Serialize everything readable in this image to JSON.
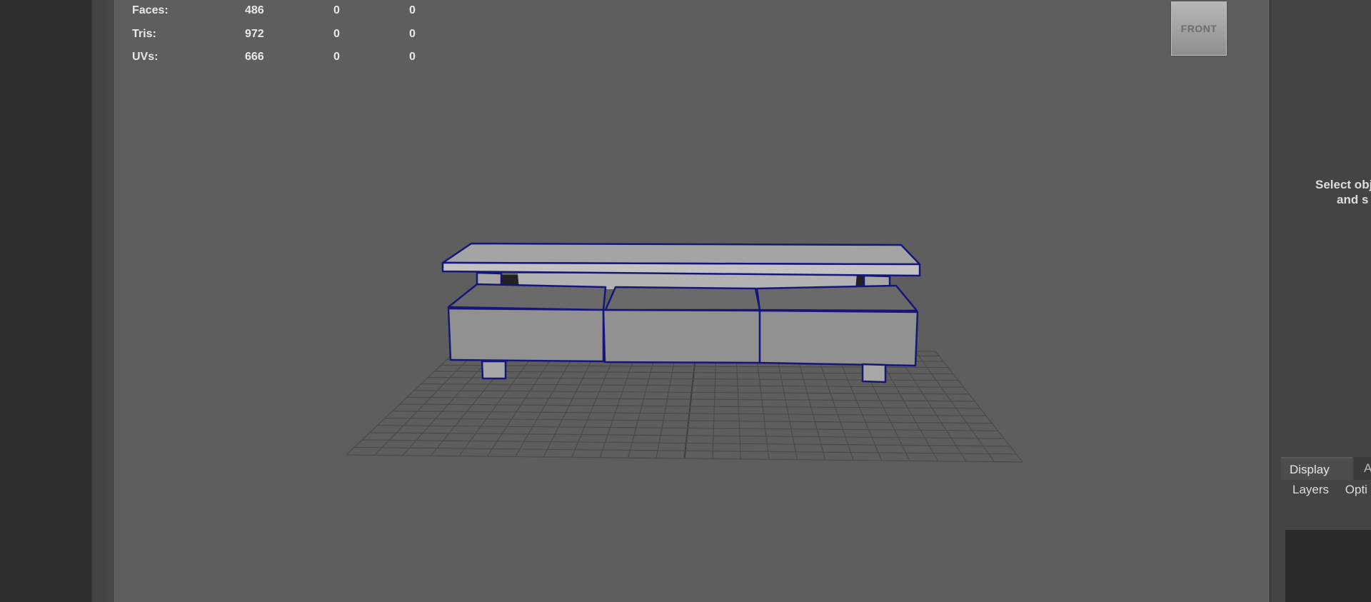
{
  "hud": {
    "rows": [
      {
        "label": "Faces:",
        "v1": "486",
        "v2": "0",
        "v3": "0"
      },
      {
        "label": "Tris:",
        "v1": "972",
        "v2": "0",
        "v3": "0"
      },
      {
        "label": "UVs:",
        "v1": "666",
        "v2": "0",
        "v3": "0"
      }
    ]
  },
  "viewcube": {
    "label": "FRONT"
  },
  "right_panel": {
    "message_line1": "Select obj",
    "message_line2": "and s",
    "tabs": [
      {
        "label": "Display"
      },
      {
        "label": "A"
      }
    ],
    "menu": [
      {
        "label": "Layers"
      },
      {
        "label": "Opti"
      }
    ]
  },
  "colors": {
    "viewport_bg": "#5e5e5e",
    "wireframe_selected": "#1a1a7a",
    "mesh_face": "#909090",
    "grid": "#4a4a4a"
  }
}
